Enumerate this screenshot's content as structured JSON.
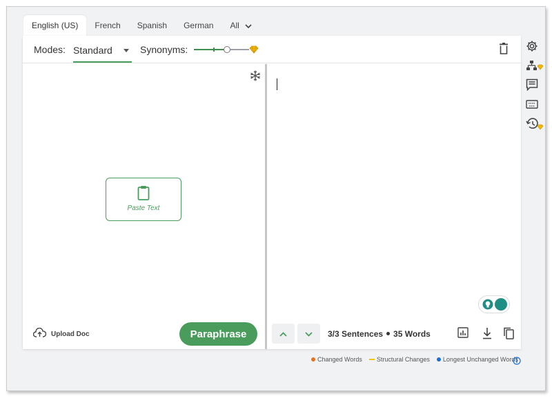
{
  "tabs": [
    {
      "label": "English (US)",
      "active": true
    },
    {
      "label": "French"
    },
    {
      "label": "Spanish"
    },
    {
      "label": "German"
    },
    {
      "label": "All"
    }
  ],
  "toolbar": {
    "modes_label": "Modes:",
    "mode_value": "Standard",
    "synonyms_label": "Synonyms:",
    "synonyms_level": 0.6
  },
  "input": {
    "paste_label": "Paste Text",
    "upload_label": "Upload Doc",
    "paraphrase_label": "Paraphrase"
  },
  "output": {
    "sentences": "3/3 Sentences",
    "words": "35 Words"
  },
  "legend": [
    {
      "label": "Changed Words",
      "color": "#e8731f"
    },
    {
      "label": "Structural Changes",
      "color": "#f2c300"
    },
    {
      "label": "Longest Unchanged Words",
      "color": "#1b6fd1"
    }
  ],
  "colors": {
    "accent": "#4a9c5d",
    "premium": "#f2b705",
    "toggle": "#1f8f83"
  },
  "rail_icons": [
    "settings-icon",
    "hierarchy-icon",
    "comment-icon",
    "keyboard-icon",
    "history-icon"
  ]
}
